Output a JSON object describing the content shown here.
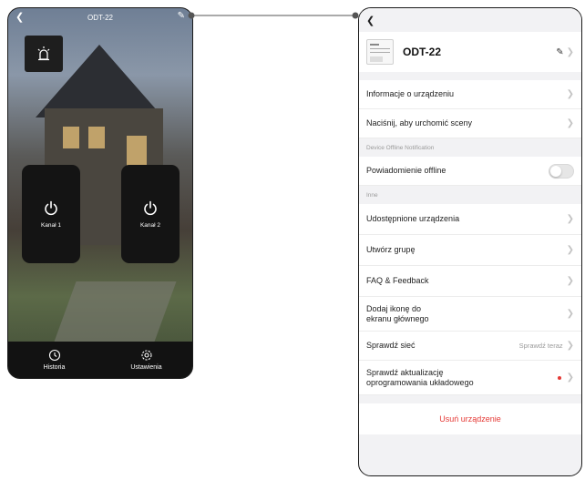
{
  "left_phone": {
    "title": "ODT-22",
    "channels": [
      {
        "label": "Kanał 1"
      },
      {
        "label": "Kanał 2"
      }
    ],
    "tabs": [
      {
        "label": "Historia",
        "icon": "history-icon"
      },
      {
        "label": "Ustawienia",
        "icon": "settings-gear-icon"
      }
    ]
  },
  "right_phone": {
    "device_name": "ODT-22",
    "rows_top": [
      {
        "label": "Informacje o urządzeniu"
      },
      {
        "label": "Naciśnij, aby urchomić sceny"
      }
    ],
    "section_offline": "Device Offline Notification",
    "offline_row": {
      "label": "Powiadomienie offline",
      "enabled": false
    },
    "section_other": "Inne",
    "rows_other": [
      {
        "label": "Udostępnione urządzenia"
      },
      {
        "label": "Utwórz grupę"
      },
      {
        "label": "FAQ & Feedback"
      }
    ],
    "home_icon_row": {
      "line1": "Dodaj ikonę do",
      "line2": "ekranu głównego"
    },
    "network_row": {
      "label": "Sprawdź sieć",
      "action": "Sprawdź teraz"
    },
    "firmware_row": {
      "line1": "Sprawdź aktualizację",
      "line2": "oprogramowania układowego"
    },
    "remove_label": "Usuń urządzenie",
    "colors": {
      "accent_red": "#e53935",
      "toggle_off": "#e6e6e6"
    }
  }
}
